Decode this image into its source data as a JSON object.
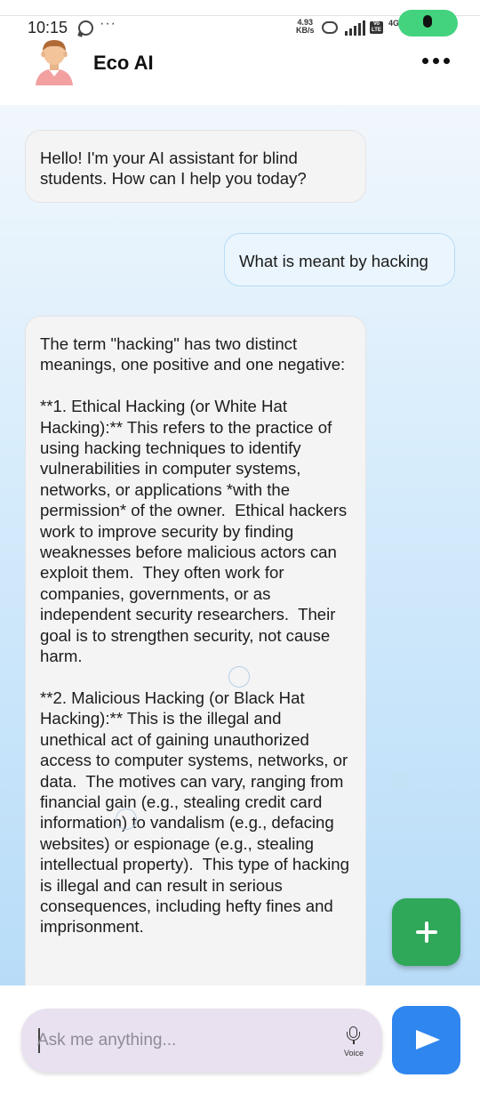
{
  "status_bar": {
    "time": "10:15",
    "more": "···",
    "net_speed_value": "4.93",
    "net_speed_unit": "KB/s",
    "volte_badge": "Vo LTE",
    "network_type": "4G"
  },
  "header": {
    "title": "Eco AI",
    "avatar_icon": "person-avatar-icon",
    "menu_icon": "three-dots-icon"
  },
  "chat": {
    "messages": [
      {
        "role": "assistant",
        "text": "Hello! I'm your AI assistant for blind students. How can I help you today?"
      },
      {
        "role": "user",
        "text": "What is meant by hacking"
      },
      {
        "role": "assistant",
        "text": "The term \"hacking\" has two distinct meanings, one positive and one negative:\n\n**1. Ethical Hacking (or White Hat Hacking):** This refers to the practice of using hacking techniques to identify vulnerabilities in computer systems, networks, or applications *with the permission* of the owner.  Ethical hackers work to improve security by finding weaknesses before malicious actors can exploit them.  They often work for companies, governments, or as independent security researchers.  Their goal is to strengthen security, not cause harm.\n\n**2. Malicious Hacking (or Black Hat Hacking):** This is the illegal and unethical act of gaining unauthorized access to computer systems, networks, or data.  The motives can vary, ranging from financial gain (e.g., stealing credit card information) to vandalism (e.g., defacing websites) or espionage (e.g., stealing intellectual property).  This type of hacking is illegal and can result in serious consequences, including hefty fines and imprisonment."
      }
    ]
  },
  "fab": {
    "icon": "plus-icon"
  },
  "input": {
    "placeholder": "Ask me anything...",
    "value": "",
    "voice_label": "Voice",
    "send_icon": "send-icon"
  },
  "colors": {
    "accent_green": "#2fa85a",
    "send_blue": "#2f86ef",
    "mic_pill_green": "#43d37f",
    "input_bg": "#e9e1ef"
  }
}
